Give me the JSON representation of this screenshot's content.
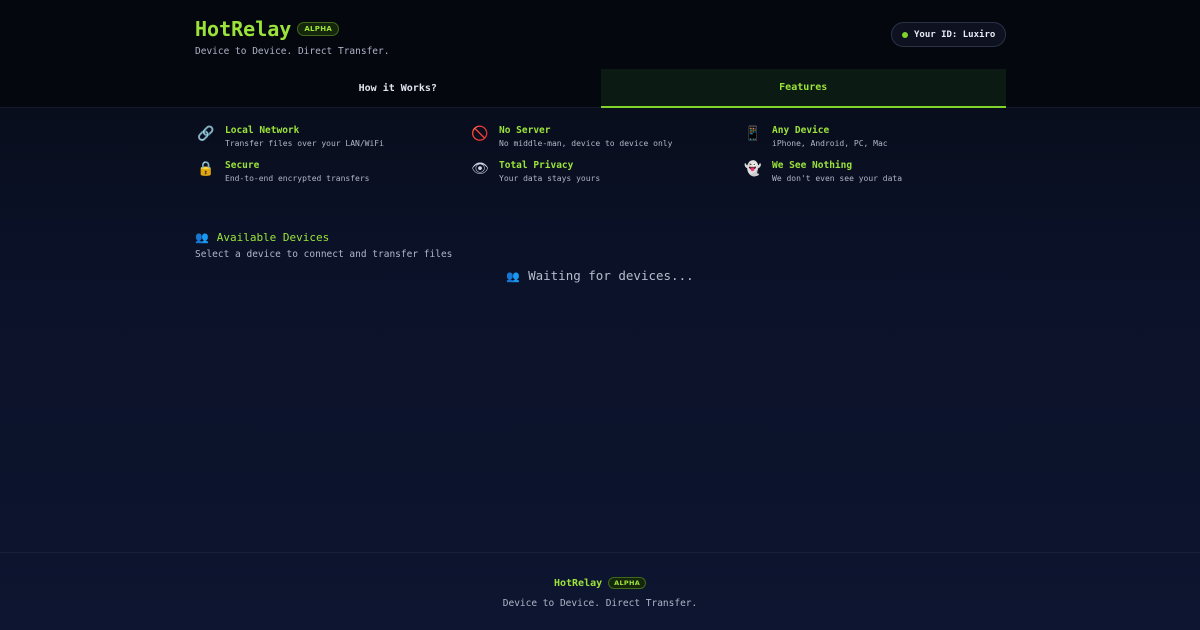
{
  "header": {
    "title": "HotRelay",
    "badge": "ALPHA",
    "tagline": "Device to Device. Direct Transfer.",
    "user_id_label": "Your ID: Luxiro",
    "status_color": "#7fd32b"
  },
  "tabs": [
    {
      "label": "How it Works?",
      "active": false
    },
    {
      "label": "Features",
      "active": true
    }
  ],
  "features": [
    {
      "icon": "link-icon",
      "glyph": "🔗",
      "title": "Local Network",
      "desc": "Transfer files over your LAN/WiFi"
    },
    {
      "icon": "no-entry-icon",
      "glyph": "🚫",
      "title": "No Server",
      "desc": "No middle-man, device to device only"
    },
    {
      "icon": "phone-icon",
      "glyph": "📱",
      "title": "Any Device",
      "desc": "iPhone, Android, PC, Mac"
    },
    {
      "icon": "lock-icon",
      "glyph": "🔒",
      "title": "Secure",
      "desc": "End-to-end encrypted transfers"
    },
    {
      "icon": "eye-icon",
      "glyph": "👁",
      "title": "Total Privacy",
      "desc": "Your data stays yours"
    },
    {
      "icon": "ghost-icon",
      "glyph": "👻",
      "title": "We See Nothing",
      "desc": "We don't even see your data"
    }
  ],
  "devices": {
    "title": "Available Devices",
    "subtitle": "Select a device to connect and transfer files",
    "waiting": "Waiting for devices..."
  },
  "footer": {
    "title": "HotRelay",
    "badge": "ALPHA",
    "tagline": "Device to Device. Direct Transfer."
  },
  "colors": {
    "accent": "#9be33a",
    "background": "#0b1228"
  }
}
